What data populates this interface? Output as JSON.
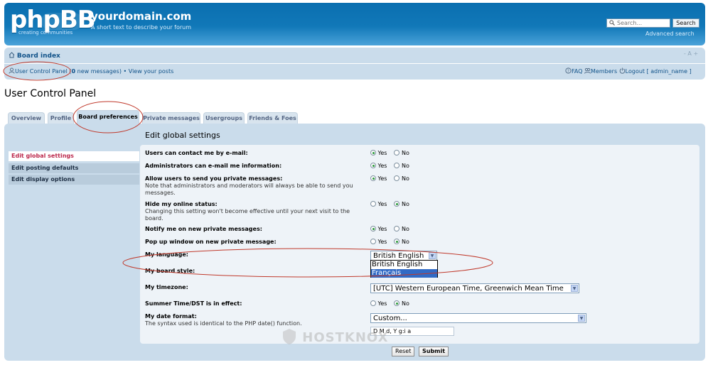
{
  "header": {
    "logo_text": "phpBB",
    "logo_tagline": "creating communities",
    "site_title": "yourdomain.com",
    "site_description": "A short text to describe your forum",
    "search_placeholder": "Search...",
    "search_button": "Search",
    "advanced_search": "Advanced search"
  },
  "nav": {
    "board_index": "Board index",
    "font_size_control": "- A +",
    "ucp_link": "User Control Panel",
    "new_messages_count": "0",
    "new_messages_suffix": "new messages",
    "view_posts": "View your posts",
    "faq": "FAQ",
    "members": "Members",
    "logout": "Logout [ admin_name ]"
  },
  "page_title": "User Control Panel",
  "tabs": [
    {
      "label": "Overview"
    },
    {
      "label": "Profile"
    },
    {
      "label": "Board preferences",
      "active": true
    },
    {
      "label": "Private messages"
    },
    {
      "label": "Usergroups"
    },
    {
      "label": "Friends & Foes"
    }
  ],
  "sidebar": [
    {
      "label": "Edit global settings",
      "active": true
    },
    {
      "label": "Edit posting defaults"
    },
    {
      "label": "Edit display options"
    }
  ],
  "panel_heading": "Edit global settings",
  "radio_labels": {
    "yes": "Yes",
    "no": "No"
  },
  "settings": [
    {
      "label": "Users can contact me by e-mail:",
      "value": "Yes"
    },
    {
      "label": "Administrators can e-mail me information:",
      "value": "Yes"
    },
    {
      "label": "Allow users to send you private messages:",
      "explain": "Note that administrators and moderators will always be able to send you messages.",
      "value": "Yes"
    },
    {
      "label": "Hide my online status:",
      "explain": "Changing this setting won't become effective until your next visit to the board.",
      "value": "No"
    },
    {
      "label": "Notify me on new private messages:",
      "value": "Yes"
    },
    {
      "label": "Pop up window on new private message:",
      "value": "No"
    },
    {
      "label": "Summer Time/DST is in effect:",
      "value": "No"
    }
  ],
  "language": {
    "label": "My language:",
    "selected": "British English",
    "options": [
      "British English",
      "Français"
    ],
    "highlighted": "Français"
  },
  "board_style_label": "My board style:",
  "timezone": {
    "label": "My timezone:",
    "selected": "[UTC] Western European Time, Greenwich Mean Time"
  },
  "date_format": {
    "label": "My date format:",
    "explain": "The syntax used is identical to the PHP date() function.",
    "selected": "Custom...",
    "custom_value": "D M d, Y g:i a"
  },
  "buttons": {
    "reset": "Reset",
    "submit": "Submit"
  },
  "watermark": "HOSTKNOX",
  "colors": {
    "header_blue": "#1178b8",
    "panel_bg": "#cadceb",
    "link_blue": "#105289",
    "active_side_item": "#bc2a4d",
    "annotation_red": "#c0392b"
  }
}
